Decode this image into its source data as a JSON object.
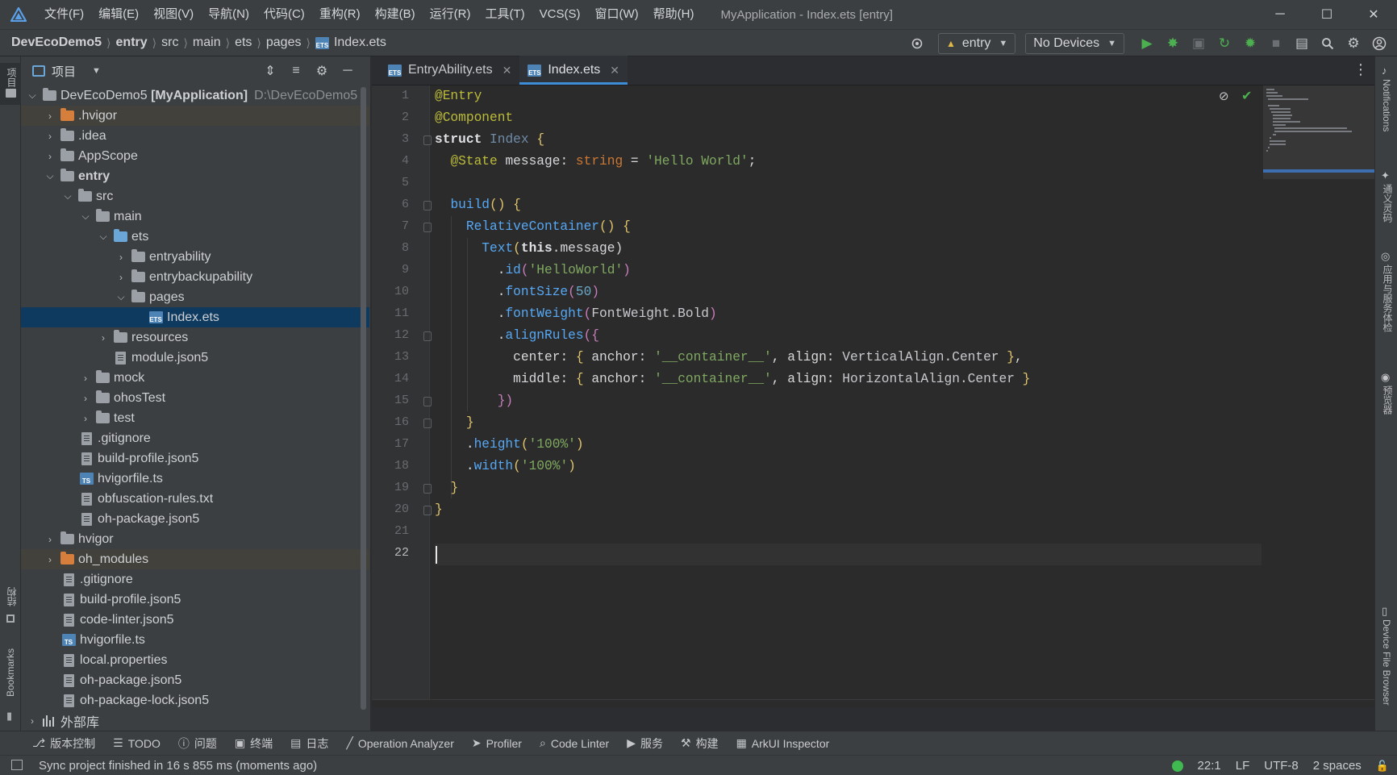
{
  "colors": {
    "accent": "#3d8ed6",
    "selection": "#0d3a5e",
    "status_ok": "#3fb950",
    "run_green": "#4caf50"
  },
  "titlebar": {
    "menu": [
      "文件(F)",
      "编辑(E)",
      "视图(V)",
      "导航(N)",
      "代码(C)",
      "重构(R)",
      "构建(B)",
      "运行(R)",
      "工具(T)",
      "VCS(S)",
      "窗口(W)",
      "帮助(H)"
    ],
    "window_title": "MyApplication - Index.ets [entry]"
  },
  "breadcrumb": [
    "DevEcoDemo5",
    "entry",
    "src",
    "main",
    "ets",
    "pages",
    "Index.ets"
  ],
  "toolbar": {
    "module_combo": "entry",
    "device_combo": "No Devices"
  },
  "project_panel": {
    "title": "项目",
    "rows": [
      {
        "label": "DevEcoDemo5",
        "suffix": "[MyApplication]",
        "hint": "D:\\DevEcoDemo5"
      },
      {
        "label": ".hvigor"
      },
      {
        "label": ".idea"
      },
      {
        "label": "AppScope"
      },
      {
        "label": "entry"
      },
      {
        "label": "src"
      },
      {
        "label": "main"
      },
      {
        "label": "ets"
      },
      {
        "label": "entryability"
      },
      {
        "label": "entrybackupability"
      },
      {
        "label": "pages"
      },
      {
        "label": "Index.ets"
      },
      {
        "label": "resources"
      },
      {
        "label": "module.json5"
      },
      {
        "label": "mock"
      },
      {
        "label": "ohosTest"
      },
      {
        "label": "test"
      },
      {
        "label": ".gitignore"
      },
      {
        "label": "build-profile.json5"
      },
      {
        "label": "hvigorfile.ts"
      },
      {
        "label": "obfuscation-rules.txt"
      },
      {
        "label": "oh-package.json5"
      },
      {
        "label": "hvigor"
      },
      {
        "label": "oh_modules"
      },
      {
        "label": ".gitignore"
      },
      {
        "label": "build-profile.json5"
      },
      {
        "label": "code-linter.json5"
      },
      {
        "label": "hvigorfile.ts"
      },
      {
        "label": "local.properties"
      },
      {
        "label": "oh-package.json5"
      },
      {
        "label": "oh-package-lock.json5"
      },
      {
        "label": "外部库"
      }
    ]
  },
  "editor": {
    "tabs": [
      {
        "label": "EntryAbility.ets"
      },
      {
        "label": "Index.ets"
      }
    ],
    "line_numbers": [
      "1",
      "2",
      "3",
      "4",
      "5",
      "6",
      "7",
      "8",
      "9",
      "10",
      "11",
      "12",
      "13",
      "14",
      "15",
      "16",
      "17",
      "18",
      "19",
      "20",
      "21",
      "22"
    ],
    "code": {
      "l1": "@Entry",
      "l2": "@Component",
      "l3_kw": "struct",
      "l3_name": "Index",
      "l3_brace": "{",
      "l4_ann": "@State",
      "l4_name": "message",
      "l4_colon": ":",
      "l4_type": "string",
      "l4_eq": "=",
      "l4_str": "'Hello World'",
      "l4_semi": ";",
      "l6_fn": "build",
      "l6_rest": "() {",
      "l7_fn": "RelativeContainer",
      "l7_rest": "() {",
      "l8_fn": "Text",
      "l8_open": "(",
      "l8_this": "this",
      "l8_rest": ".message)",
      "l9_dot": ".",
      "l9_fn": "id",
      "l9_open": "(",
      "l9_str": "'HelloWorld'",
      "l9_close": ")",
      "l10_fn": "fontSize",
      "l10_num": "50",
      "l11_fn": "fontWeight",
      "l11_arg": "FontWeight.Bold",
      "l12_fn": "alignRules",
      "l12_rest": "({",
      "l13_key": "center",
      "l13_anchor": "anchor",
      "l13_str": "'__container__'",
      "l13_align": "align",
      "l13_val": "VerticalAlign.Center",
      "l14_key": "middle",
      "l14_anchor": "anchor",
      "l14_str": "'__container__'",
      "l14_align": "align",
      "l14_val": "HorizontalAlign.Center",
      "l15": "})",
      "l16": "}",
      "l17_fn": "height",
      "l17_str": "'100%'",
      "l18_fn": "width",
      "l18_str": "'100%'",
      "l19": "}",
      "l20": "}"
    }
  },
  "left_stripe": {
    "project": "项目",
    "structure": "结构",
    "bookmarks": "Bookmarks"
  },
  "right_stripe": {
    "notifications": "Notifications",
    "tongyi": "通义灵码",
    "app_service": "应用与服务体检",
    "previewer": "预览器",
    "device_file_browser": "Device File Browser"
  },
  "bottom_tools": [
    "版本控制",
    "TODO",
    "问题",
    "终端",
    "日志",
    "Operation Analyzer",
    "Profiler",
    "Code Linter",
    "服务",
    "构建",
    "ArkUI Inspector"
  ],
  "status": {
    "message": "Sync project finished in 16 s 855 ms (moments ago)",
    "position": "22:1",
    "line_sep": "LF",
    "encoding": "UTF-8",
    "indent": "2 spaces"
  }
}
